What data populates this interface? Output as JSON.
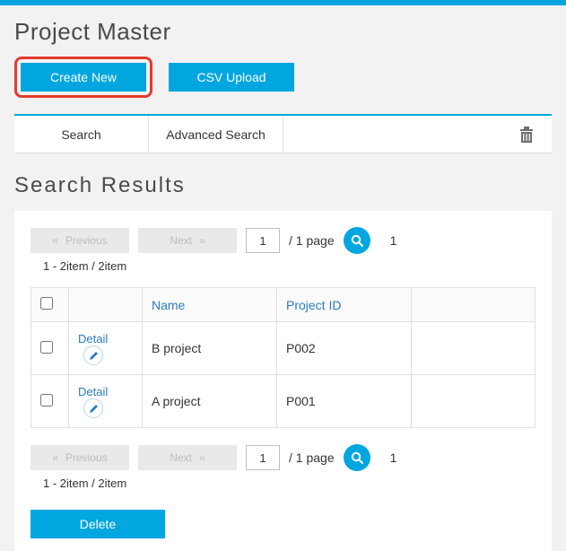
{
  "page_title": "Project Master",
  "actions": {
    "create_new": "Create New",
    "csv_upload": "CSV Upload"
  },
  "tabs": {
    "search": "Search",
    "advanced_search": "Advanced Search"
  },
  "results_title": "Search Results",
  "pager": {
    "prev_label": "Previous",
    "next_label": "Next",
    "prev_glyph": "«",
    "next_glyph": "»",
    "page_value": "1",
    "page_total": "/  1 page",
    "result_count": "1",
    "range_text": "1 - 2item / 2item"
  },
  "columns": {
    "name": "Name",
    "project_id": "Project ID"
  },
  "rows": [
    {
      "detail": "Detail",
      "name": "B project",
      "project_id": "P002"
    },
    {
      "detail": "Detail",
      "name": "A project",
      "project_id": "P001"
    }
  ],
  "delete_label": "Delete"
}
